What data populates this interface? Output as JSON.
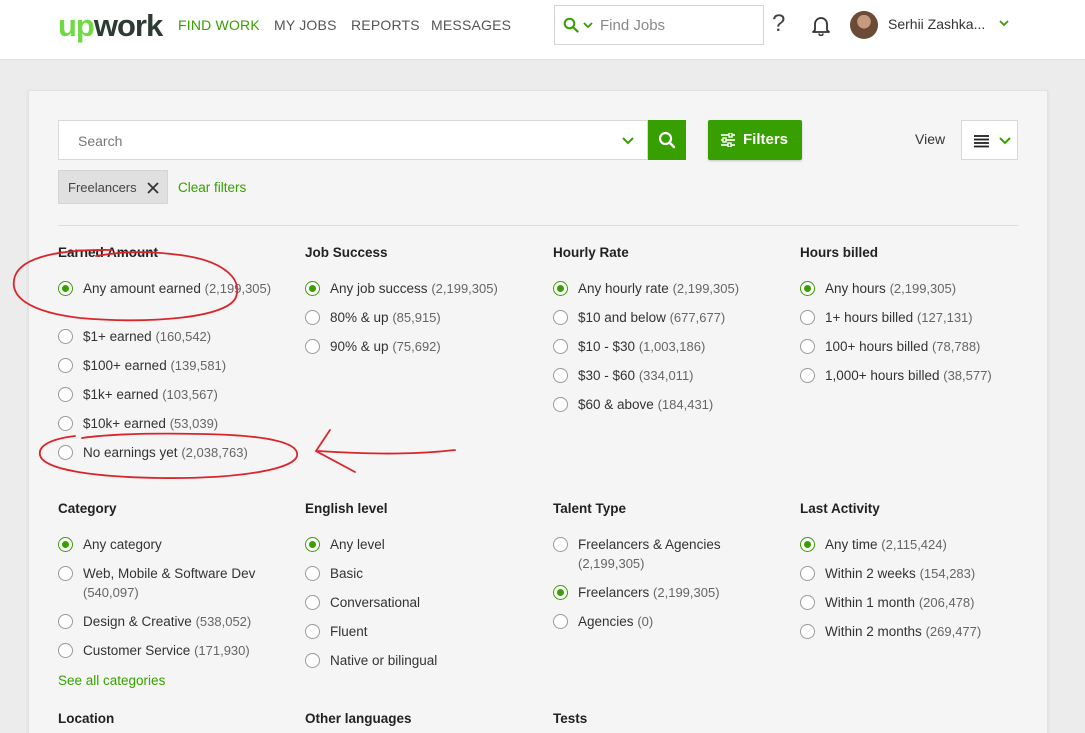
{
  "header": {
    "logo_up": "up",
    "logo_work": "work",
    "nav": [
      {
        "label": "FIND WORK",
        "active": true
      },
      {
        "label": "MY JOBS",
        "active": false
      },
      {
        "label": "REPORTS",
        "active": false
      },
      {
        "label": "MESSAGES",
        "active": false
      }
    ],
    "search_placeholder": "Find Jobs",
    "help_glyph": "?",
    "user_name": "Serhii Zashka..."
  },
  "toolbar": {
    "search_placeholder": "Search",
    "filters_label": "Filters",
    "view_label": "View"
  },
  "active_filters": {
    "chip_label": "Freelancers",
    "clear_label": "Clear filters"
  },
  "groups": {
    "earned": {
      "title": "Earned Amount",
      "options": [
        {
          "label": "Any amount earned",
          "count": "(2,199,305)",
          "selected": true,
          "wrap": true
        },
        {
          "label": "$1+ earned",
          "count": "(160,542)",
          "selected": false
        },
        {
          "label": "$100+ earned",
          "count": "(139,581)",
          "selected": false
        },
        {
          "label": "$1k+ earned",
          "count": "(103,567)",
          "selected": false
        },
        {
          "label": "$10k+ earned",
          "count": "(53,039)",
          "selected": false
        },
        {
          "label": "No earnings yet",
          "count": "(2,038,763)",
          "selected": false
        }
      ]
    },
    "job_success": {
      "title": "Job Success",
      "options": [
        {
          "label": "Any job success",
          "count": "(2,199,305)",
          "selected": true
        },
        {
          "label": "80% & up",
          "count": "(85,915)",
          "selected": false
        },
        {
          "label": "90% & up",
          "count": "(75,692)",
          "selected": false
        }
      ]
    },
    "hourly_rate": {
      "title": "Hourly Rate",
      "options": [
        {
          "label": "Any hourly rate",
          "count": "(2,199,305)",
          "selected": true
        },
        {
          "label": "$10 and below",
          "count": "(677,677)",
          "selected": false
        },
        {
          "label": "$10 - $30",
          "count": "(1,003,186)",
          "selected": false
        },
        {
          "label": "$30 - $60",
          "count": "(334,011)",
          "selected": false
        },
        {
          "label": "$60 & above",
          "count": "(184,431)",
          "selected": false
        }
      ]
    },
    "hours_billed": {
      "title": "Hours billed",
      "options": [
        {
          "label": "Any hours",
          "count": "(2,199,305)",
          "selected": true
        },
        {
          "label": "1+ hours billed",
          "count": "(127,131)",
          "selected": false
        },
        {
          "label": "100+ hours billed",
          "count": "(78,788)",
          "selected": false
        },
        {
          "label": "1,000+ hours billed",
          "count": "(38,577)",
          "selected": false
        }
      ]
    },
    "category": {
      "title": "Category",
      "options": [
        {
          "label": "Any category",
          "count": "",
          "selected": true
        },
        {
          "label": "Web, Mobile & Software Dev",
          "count": "(540,097)",
          "selected": false,
          "wrap": true
        },
        {
          "label": "Design & Creative",
          "count": "(538,052)",
          "selected": false
        },
        {
          "label": "Customer Service",
          "count": "(171,930)",
          "selected": false
        }
      ],
      "see_all": "See all categories"
    },
    "english": {
      "title": "English level",
      "options": [
        {
          "label": "Any level",
          "count": "",
          "selected": true
        },
        {
          "label": "Basic",
          "count": "",
          "selected": false
        },
        {
          "label": "Conversational",
          "count": "",
          "selected": false
        },
        {
          "label": "Fluent",
          "count": "",
          "selected": false
        },
        {
          "label": "Native or bilingual",
          "count": "",
          "selected": false
        }
      ]
    },
    "talent_type": {
      "title": "Talent Type",
      "options": [
        {
          "label": "Freelancers & Agencies",
          "count": "(2,199,305)",
          "selected": false,
          "wrap": true
        },
        {
          "label": "Freelancers",
          "count": "(2,199,305)",
          "selected": true
        },
        {
          "label": "Agencies",
          "count": "(0)",
          "selected": false
        }
      ]
    },
    "last_activity": {
      "title": "Last Activity",
      "options": [
        {
          "label": "Any time",
          "count": "(2,115,424)",
          "selected": true
        },
        {
          "label": "Within 2 weeks",
          "count": "(154,283)",
          "selected": false
        },
        {
          "label": "Within 1 month",
          "count": "(206,478)",
          "selected": false
        },
        {
          "label": "Within 2 months",
          "count": "(269,477)",
          "selected": false
        }
      ]
    },
    "location": {
      "title": "Location",
      "options": []
    },
    "other_languages": {
      "title": "Other languages",
      "options": []
    },
    "tests": {
      "title": "Tests",
      "options": []
    }
  },
  "colors": {
    "accent": "#37a000",
    "annotation": "#d9262c"
  }
}
